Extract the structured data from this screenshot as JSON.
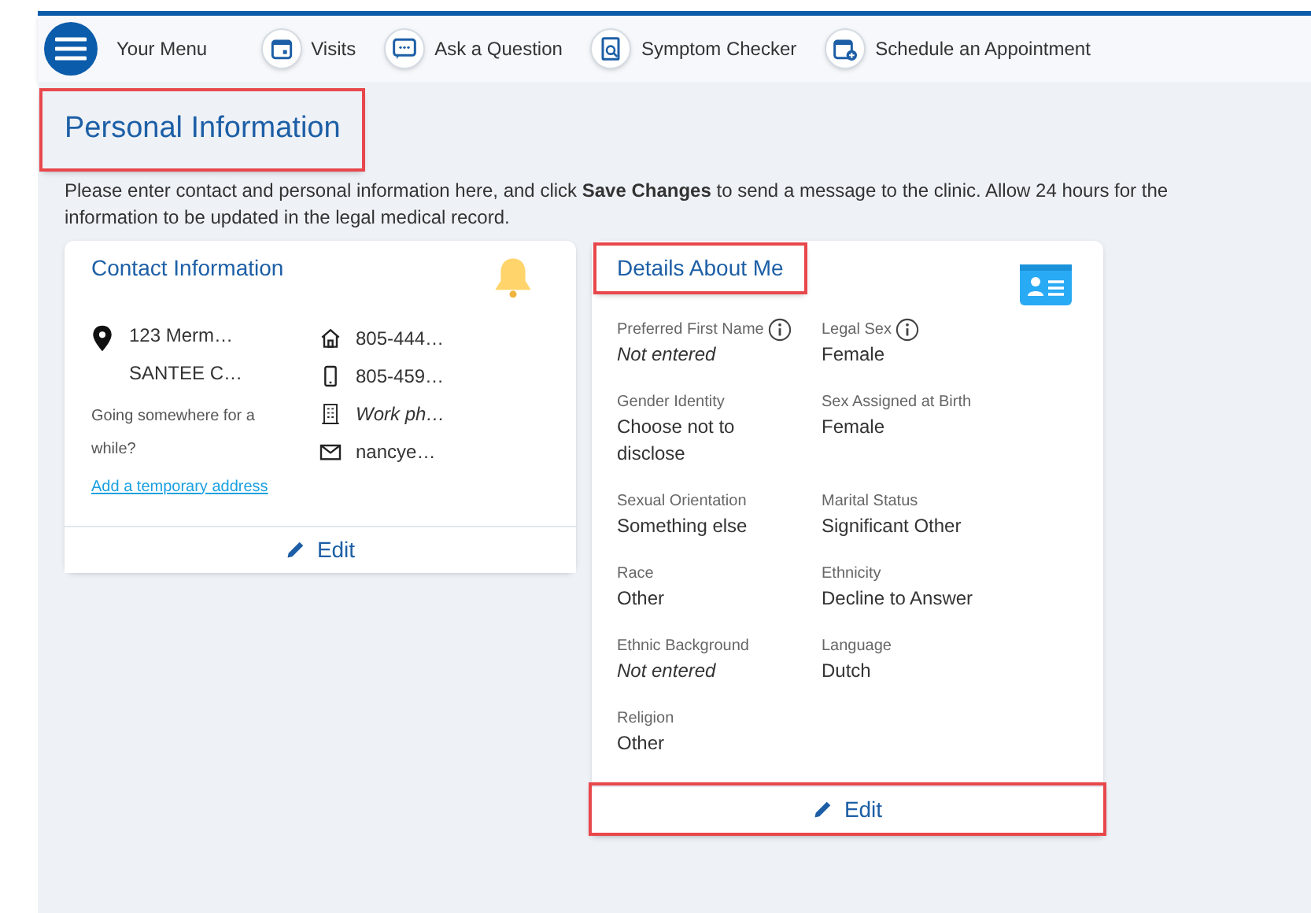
{
  "nav": {
    "menu_label": "Your Menu",
    "items": [
      {
        "kind": "visits",
        "label": "Visits"
      },
      {
        "kind": "question",
        "label": "Ask a Question"
      },
      {
        "kind": "symptom",
        "label": "Symptom Checker"
      },
      {
        "kind": "schedule",
        "label": "Schedule an Appointment"
      }
    ]
  },
  "page": {
    "title": "Personal Information",
    "title_highlighted": true,
    "intro": "Please enter contact and personal information here, and click **Save Changes** to send a message to the clinic. Allow 24 hours for the information to be updated in the legal medical record."
  },
  "contact": {
    "title": "Contact Information",
    "address": [
      "123 Merm…",
      "SANTEE C…"
    ],
    "temp_prompt": "Going somewhere for a while?",
    "temp_link": "Add a temporary address",
    "phones": [
      {
        "kind": "home",
        "text": "805-444…",
        "empty": false
      },
      {
        "kind": "mobile",
        "text": "805-459…",
        "empty": false
      },
      {
        "kind": "work",
        "text": "Work ph…",
        "empty": true
      },
      {
        "kind": "email",
        "text": "nancye…",
        "empty": false
      }
    ],
    "edit": "Edit",
    "edit_highlighted": false
  },
  "details": {
    "title": "Details About Me",
    "title_highlighted": true,
    "fields": [
      {
        "label": "Preferred First Name",
        "value": "Not entered",
        "info": true,
        "empty": true
      },
      {
        "label": "Legal Sex",
        "value": "Female",
        "info": true,
        "empty": false
      },
      {
        "label": "Gender Identity",
        "value": "Choose not to disclose",
        "info": false,
        "empty": false
      },
      {
        "label": "Sex Assigned at Birth",
        "value": "Female",
        "info": false,
        "empty": false
      },
      {
        "label": "Sexual Orientation",
        "value": "Something else",
        "info": false,
        "empty": false
      },
      {
        "label": "Marital Status",
        "value": "Significant Other",
        "info": false,
        "empty": false
      },
      {
        "label": "Race",
        "value": "Other",
        "info": false,
        "empty": false
      },
      {
        "label": "Ethnicity",
        "value": "Decline to Answer",
        "info": false,
        "empty": false
      },
      {
        "label": "Ethnic Background",
        "value": "Not entered",
        "info": false,
        "empty": true
      },
      {
        "label": "Language",
        "value": "Dutch",
        "info": false,
        "empty": false
      },
      {
        "label": "Religion",
        "value": "Other",
        "info": false,
        "empty": false
      }
    ],
    "edit": "Edit",
    "edit_highlighted": true
  }
}
